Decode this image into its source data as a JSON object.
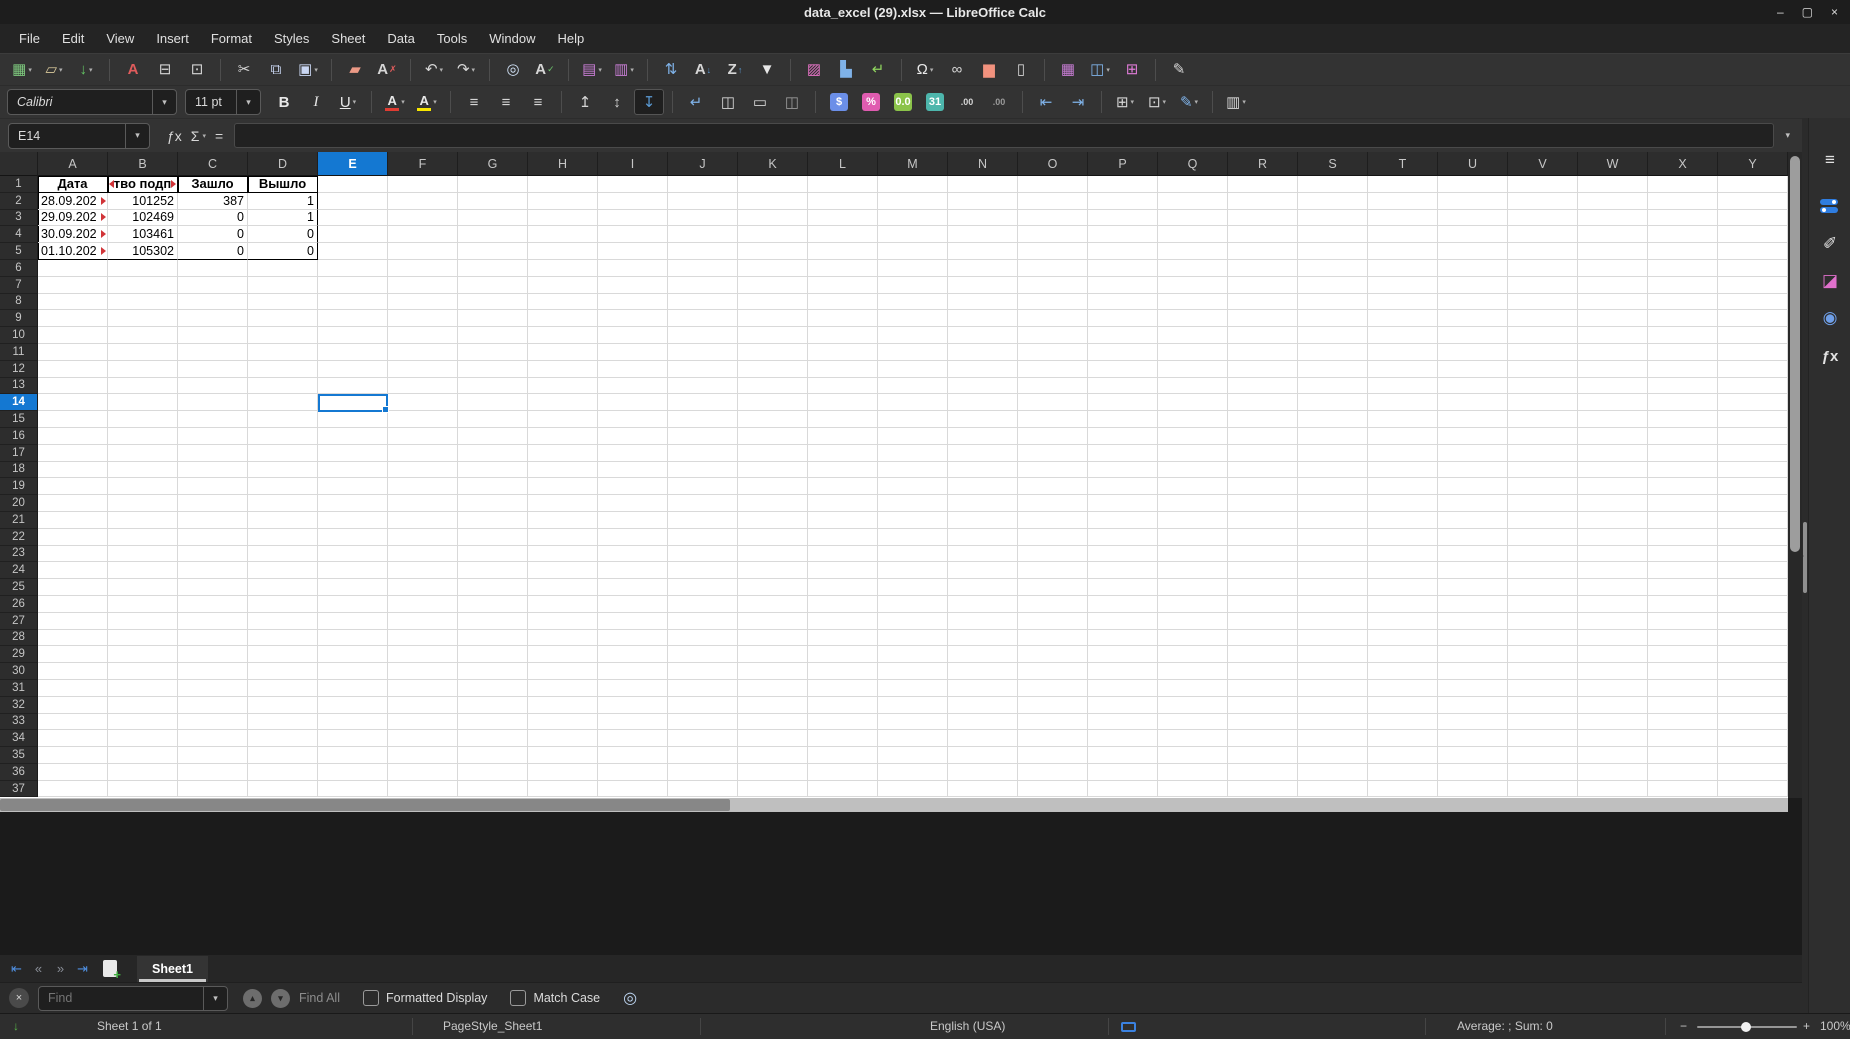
{
  "window": {
    "title": "data_excel (29).xlsx — LibreOffice Calc",
    "controls": [
      {
        "name": "minimize-button",
        "glyph": "–"
      },
      {
        "name": "maximize-button",
        "glyph": "▢"
      },
      {
        "name": "close-button",
        "glyph": "×"
      }
    ]
  },
  "menu_bar": {
    "items": [
      "File",
      "Edit",
      "View",
      "Insert",
      "Format",
      "Styles",
      "Sheet",
      "Data",
      "Tools",
      "Window",
      "Help"
    ]
  },
  "glyphs": {
    "dropdown": "▾",
    "up": "▴",
    "down": "▾",
    "left_grip": "‣"
  },
  "standard_toolbar": {
    "items": [
      {
        "t": "icon",
        "name": "new-spreadsheet-icon",
        "g": "▦",
        "c": "#7ec97e",
        "dd": true
      },
      {
        "t": "icon",
        "name": "open-icon",
        "g": "▱",
        "c": "#d8c89a",
        "dd": true
      },
      {
        "t": "icon",
        "name": "save-icon",
        "g": "↓",
        "c": "#64c764",
        "dd": true,
        "bold": true
      },
      {
        "t": "sep"
      },
      {
        "t": "icon",
        "name": "export-pdf-icon",
        "g": "A",
        "c": "#e05c5c",
        "bold": true
      },
      {
        "t": "icon",
        "name": "print-icon",
        "g": "⊟",
        "c": "#d6d6d6"
      },
      {
        "t": "icon",
        "name": "print-preview-icon",
        "g": "⊡",
        "c": "#d6d6d6"
      },
      {
        "t": "sep"
      },
      {
        "t": "icon",
        "name": "cut-icon",
        "g": "✂",
        "c": "#d6d6d6"
      },
      {
        "t": "icon",
        "name": "copy-icon",
        "g": "⧉",
        "c": "#c9d6f2"
      },
      {
        "t": "icon",
        "name": "paste-icon",
        "g": "▣",
        "c": "#c9d6f2",
        "dd": true
      },
      {
        "t": "sep"
      },
      {
        "t": "icon",
        "name": "clone-formatting-icon",
        "g": "▰",
        "c": "#ec9a86"
      },
      {
        "t": "icon",
        "name": "clear-formatting-icon",
        "g": "A",
        "c": "#d6d6d6",
        "sub": "✗",
        "subc": "#e05c5c",
        "bold": true
      },
      {
        "t": "sep"
      },
      {
        "t": "icon",
        "name": "undo-icon",
        "g": "↶",
        "c": "#d6d6d6",
        "dd": true
      },
      {
        "t": "icon",
        "name": "redo-icon",
        "g": "↷",
        "c": "#d6d6d6",
        "dd": true
      },
      {
        "t": "sep"
      },
      {
        "t": "icon",
        "name": "find-replace-icon",
        "g": "◎",
        "c": "#cfe0f4"
      },
      {
        "t": "icon",
        "name": "spelling-icon",
        "g": "A",
        "c": "#d6d6d6",
        "sub": "✓",
        "subc": "#6cc26c",
        "bold": true
      },
      {
        "t": "sep"
      },
      {
        "t": "icon",
        "name": "rows-icon",
        "g": "▤",
        "c": "#c77dd4",
        "dd": true
      },
      {
        "t": "icon",
        "name": "columns-icon",
        "g": "▥",
        "c": "#c77dd4",
        "dd": true
      },
      {
        "t": "sep"
      },
      {
        "t": "icon",
        "name": "sort-icon",
        "g": "⇅",
        "c": "#7fb2e8"
      },
      {
        "t": "icon",
        "name": "sort-ascending-icon",
        "g": "A",
        "c": "#d6d6d6",
        "sub": "↓",
        "subc": "#5b9bd5",
        "bold": true
      },
      {
        "t": "icon",
        "name": "sort-descending-icon",
        "g": "Z",
        "c": "#d6d6d6",
        "sub": "↑",
        "subc": "#5b9bd5",
        "bold": true
      },
      {
        "t": "icon",
        "name": "autofilter-icon",
        "g": "▼",
        "c": "#e8e8e8"
      },
      {
        "t": "sep"
      },
      {
        "t": "icon",
        "name": "insert-image-icon",
        "g": "▨",
        "c": "#e873c8"
      },
      {
        "t": "icon",
        "name": "insert-chart-icon",
        "g": "▙",
        "c": "#7fb2e8"
      },
      {
        "t": "icon",
        "name": "insert-pivot-table-icon",
        "g": "↵",
        "c": "#8fd45e"
      },
      {
        "t": "sep"
      },
      {
        "t": "icon",
        "name": "special-character-icon",
        "g": "Ω",
        "c": "#e8e8e8",
        "dd": true
      },
      {
        "t": "icon",
        "name": "hyperlink-icon",
        "g": "∞",
        "c": "#d6d6d6"
      },
      {
        "t": "icon",
        "name": "insert-comment-icon",
        "g": "▆",
        "c": "#f2927e"
      },
      {
        "t": "icon",
        "name": "headers-footers-icon",
        "g": "▯",
        "c": "#d6d6d6"
      },
      {
        "t": "sep"
      },
      {
        "t": "icon",
        "name": "freeze-rows-columns-icon",
        "g": "▦",
        "c": "#c77dd4"
      },
      {
        "t": "icon",
        "name": "split-window-icon",
        "g": "◫",
        "c": "#7fb2e8",
        "dd": true
      },
      {
        "t": "icon",
        "name": "show-grid-lines-icon",
        "g": "⊞",
        "c": "#e07cd8"
      },
      {
        "t": "sep"
      },
      {
        "t": "icon",
        "name": "show-draw-functions-icon",
        "g": "✎",
        "c": "#d6d6d6"
      }
    ]
  },
  "formatting_toolbar": {
    "items": [
      {
        "t": "combo",
        "name": "font-name-combo",
        "value": "Calibri",
        "w": 170,
        "italic": true
      },
      {
        "t": "combo",
        "name": "font-size-combo",
        "value": "11 pt",
        "w": 76
      },
      {
        "t": "icon",
        "name": "bold-icon",
        "g": "B",
        "c": "#e8e8e8",
        "cls": "b"
      },
      {
        "t": "icon",
        "name": "italic-icon",
        "g": "I",
        "c": "#e8e8e8",
        "cls": "i"
      },
      {
        "t": "icon",
        "name": "underline-icon",
        "g": "U",
        "c": "#e8e8e8",
        "cls": "u",
        "dd": true
      },
      {
        "t": "sep"
      },
      {
        "t": "icon",
        "name": "font-color-icon",
        "g": "A",
        "c": "#e8e8e8",
        "bar": "#e03c32",
        "dd": true
      },
      {
        "t": "icon",
        "name": "highlight-color-icon",
        "g": "A",
        "c": "#e8e8e8",
        "bar": "#f7e600",
        "dd": true
      },
      {
        "t": "sep"
      },
      {
        "t": "icon",
        "name": "align-left-icon",
        "g": "≡",
        "c": "#d6d6d6"
      },
      {
        "t": "icon",
        "name": "align-center-icon",
        "g": "≡",
        "c": "#d6d6d6"
      },
      {
        "t": "icon",
        "name": "align-right-icon",
        "g": "≡",
        "c": "#d6d6d6"
      },
      {
        "t": "sep"
      },
      {
        "t": "icon",
        "name": "align-top-icon",
        "g": "↥",
        "c": "#d6d6d6"
      },
      {
        "t": "icon",
        "name": "center-vertically-icon",
        "g": "↕",
        "c": "#d6d6d6"
      },
      {
        "t": "icon",
        "name": "align-bottom-icon",
        "g": "↧",
        "c": "#5b9bd5",
        "pressed": true
      },
      {
        "t": "sep"
      },
      {
        "t": "icon",
        "name": "wrap-text-icon",
        "g": "↵",
        "c": "#7fb2e8"
      },
      {
        "t": "icon",
        "name": "merge-center-cells-icon",
        "g": "◫",
        "c": "#d6d6d6"
      },
      {
        "t": "icon",
        "name": "merge-cells-icon",
        "g": "▭",
        "c": "#d6d6d6"
      },
      {
        "t": "icon",
        "name": "unmerge-cells-icon",
        "g": "◫",
        "c": "#9a9a9a"
      },
      {
        "t": "sep"
      },
      {
        "t": "icon",
        "name": "format-currency-icon",
        "g": "$",
        "c": "#ffffff",
        "box": "#6b8fe8"
      },
      {
        "t": "icon",
        "name": "format-percent-icon",
        "g": "%",
        "c": "#ffffff",
        "box": "#e05cb0"
      },
      {
        "t": "icon",
        "name": "format-number-icon",
        "g": "0.0",
        "c": "#ffffff",
        "box": "#8bc34a",
        "small": true
      },
      {
        "t": "icon",
        "name": "format-date-icon",
        "g": "31",
        "c": "#ffffff",
        "box": "#4db6ac",
        "small": true
      },
      {
        "t": "icon",
        "name": "add-decimal-place-icon",
        "g": ".00",
        "c": "#d6d6d6",
        "small": true
      },
      {
        "t": "icon",
        "name": "delete-decimal-place-icon",
        "g": ".00",
        "c": "#9a9a9a",
        "small": true
      },
      {
        "t": "sep"
      },
      {
        "t": "icon",
        "name": "decrease-indent-icon",
        "g": "⇤",
        "c": "#7fb2e8"
      },
      {
        "t": "icon",
        "name": "increase-indent-icon",
        "g": "⇥",
        "c": "#7fb2e8"
      },
      {
        "t": "sep"
      },
      {
        "t": "icon",
        "name": "borders-icon",
        "g": "⊞",
        "c": "#d6d6d6",
        "dd": true
      },
      {
        "t": "icon",
        "name": "border-style-icon",
        "g": "⊡",
        "c": "#d6d6d6",
        "dd": true
      },
      {
        "t": "icon",
        "name": "border-color-icon",
        "g": "✎",
        "c": "#7fb2e8",
        "dd": true
      },
      {
        "t": "sep"
      },
      {
        "t": "icon",
        "name": "conditional-formatting-icon",
        "g": "▥",
        "c": "#d6d6d6",
        "dd": true
      }
    ]
  },
  "formula_bar": {
    "cell_reference": "E14",
    "formula_value": "",
    "icons": [
      {
        "name": "function-wizard-icon",
        "g": "ƒx"
      },
      {
        "name": "select-function-icon",
        "g": "Σ",
        "dd": true
      },
      {
        "name": "formula-icon",
        "g": "="
      }
    ]
  },
  "grid": {
    "columns": [
      "A",
      "B",
      "C",
      "D",
      "E",
      "F",
      "G",
      "H",
      "I",
      "J",
      "K",
      "L",
      "M",
      "N",
      "O",
      "P",
      "Q",
      "R",
      "S",
      "T",
      "U",
      "V",
      "W",
      "X",
      "Y"
    ],
    "row_count": 37,
    "selected_column": "E",
    "selected_row": 14,
    "header_cells": [
      "Дата",
      "тво подп",
      "Зашло",
      "Вышло"
    ],
    "data_rows": [
      [
        "28.09.202",
        "101252",
        "387",
        "1"
      ],
      [
        "29.09.202",
        "102469",
        "0",
        "1"
      ],
      [
        "30.09.202",
        "103461",
        "0",
        "0"
      ],
      [
        "01.10.202",
        "105302",
        "0",
        "0"
      ]
    ]
  },
  "sheet_tabs": {
    "nav": [
      {
        "name": "first-sheet-icon",
        "g": "⇤",
        "c": "#4f8fe0"
      },
      {
        "name": "previous-sheet-icon",
        "g": "«",
        "c": "#8a8f98"
      },
      {
        "name": "next-sheet-icon",
        "g": "»",
        "c": "#8a8f98"
      },
      {
        "name": "last-sheet-icon",
        "g": "⇥",
        "c": "#4f8fe0"
      }
    ],
    "add_label": "+",
    "tabs": [
      {
        "label": "Sheet1",
        "active": true
      }
    ]
  },
  "find_bar": {
    "close_glyph": "×",
    "placeholder": "Find",
    "find_all_label": "Find All",
    "formatted_display_label": "Formatted Display",
    "match_case_label": "Match Case",
    "find_replace_glyph": "◎"
  },
  "status_bar": {
    "position_glyph": "↓",
    "sheet_info": "Sheet 1 of 1",
    "page_style": "PageStyle_Sheet1",
    "language": "English (USA)",
    "average_sum": "Average: ; Sum: 0",
    "zoom_out": "−",
    "zoom_in": "+",
    "zoom_level": "100%"
  },
  "sidebar": {
    "icons": [
      {
        "name": "sidebar-settings-icon",
        "g": "≡",
        "c": "#e2e2e2"
      },
      {
        "name": "properties-icon",
        "kind": "toggles"
      },
      {
        "name": "styles-icon",
        "g": "✐",
        "c": "#e2e2e2"
      },
      {
        "name": "gallery-icon",
        "g": "◪",
        "c": "#e070cc"
      },
      {
        "name": "navigator-icon",
        "g": "◉",
        "c": "#6f9fe8"
      },
      {
        "name": "functions-icon",
        "g": "ƒx",
        "c": "#e2e2e2"
      }
    ]
  },
  "colors": {
    "accent": "#1478d2",
    "overflow_marker": "#d13438",
    "selected_header": "#1478d2"
  }
}
